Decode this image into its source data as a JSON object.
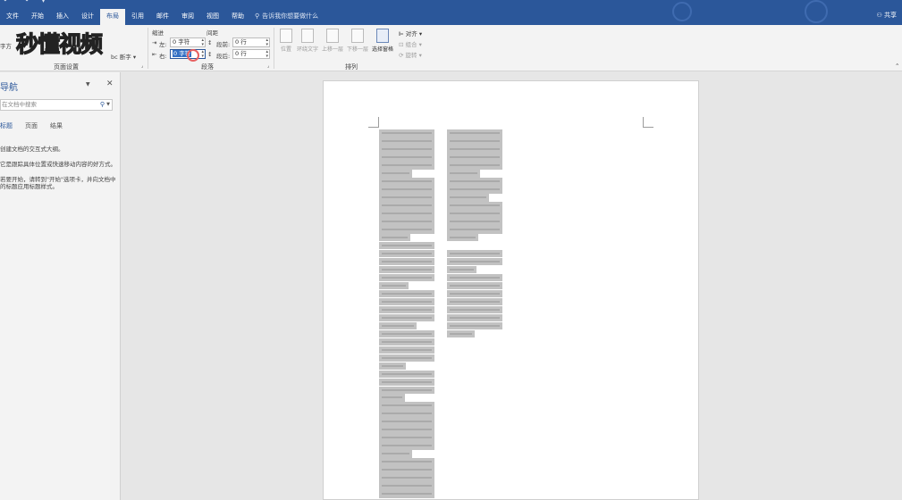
{
  "ribbon_tabs": [
    "文件",
    "开始",
    "插入",
    "设计",
    "布局",
    "引用",
    "邮件",
    "审阅",
    "视图",
    "帮助"
  ],
  "active_tab": "布局",
  "tell_me": "告诉我你想要做什么",
  "share": "共享",
  "watermark_logo": "秒懂视频",
  "page_setup": {
    "group_label": "页面设置",
    "orientation_label": "字方",
    "breaks_label": "断字"
  },
  "paragraph": {
    "group_label": "段落",
    "indent_header": "缩进",
    "spacing_header": "间距",
    "left_label": "左:",
    "left_value": "0 字符",
    "right_label": "右:",
    "right_value": "0 字符",
    "before_label": "段前:",
    "before_value": "0 行",
    "after_label": "段后:",
    "after_value": "0 行"
  },
  "arrange": {
    "group_label": "排列",
    "position": "位置",
    "wrap_text": "环绕文字",
    "bring_forward": "上移一层",
    "send_backward": "下移一层",
    "selection_pane": "选择窗格",
    "align": "对齐",
    "group": "组合",
    "rotate": "旋转"
  },
  "nav_pane": {
    "title": "导航",
    "search_placeholder": "在文档中搜索",
    "tabs": [
      "标题",
      "页面",
      "结果"
    ],
    "active_tab": "标题",
    "message_1": "创建文档的交互式大纲。",
    "message_2": "它是跟踪具体位置或快速移动内容的好方式。",
    "message_3": "若要开始，请转到\"开始\"选项卡，并向文档中的标题应用标题样式。"
  },
  "colors": {
    "brand_blue": "#2b579a",
    "ribbon_bg": "#f3f3f3",
    "selection_gray": "#c2c2c2"
  }
}
